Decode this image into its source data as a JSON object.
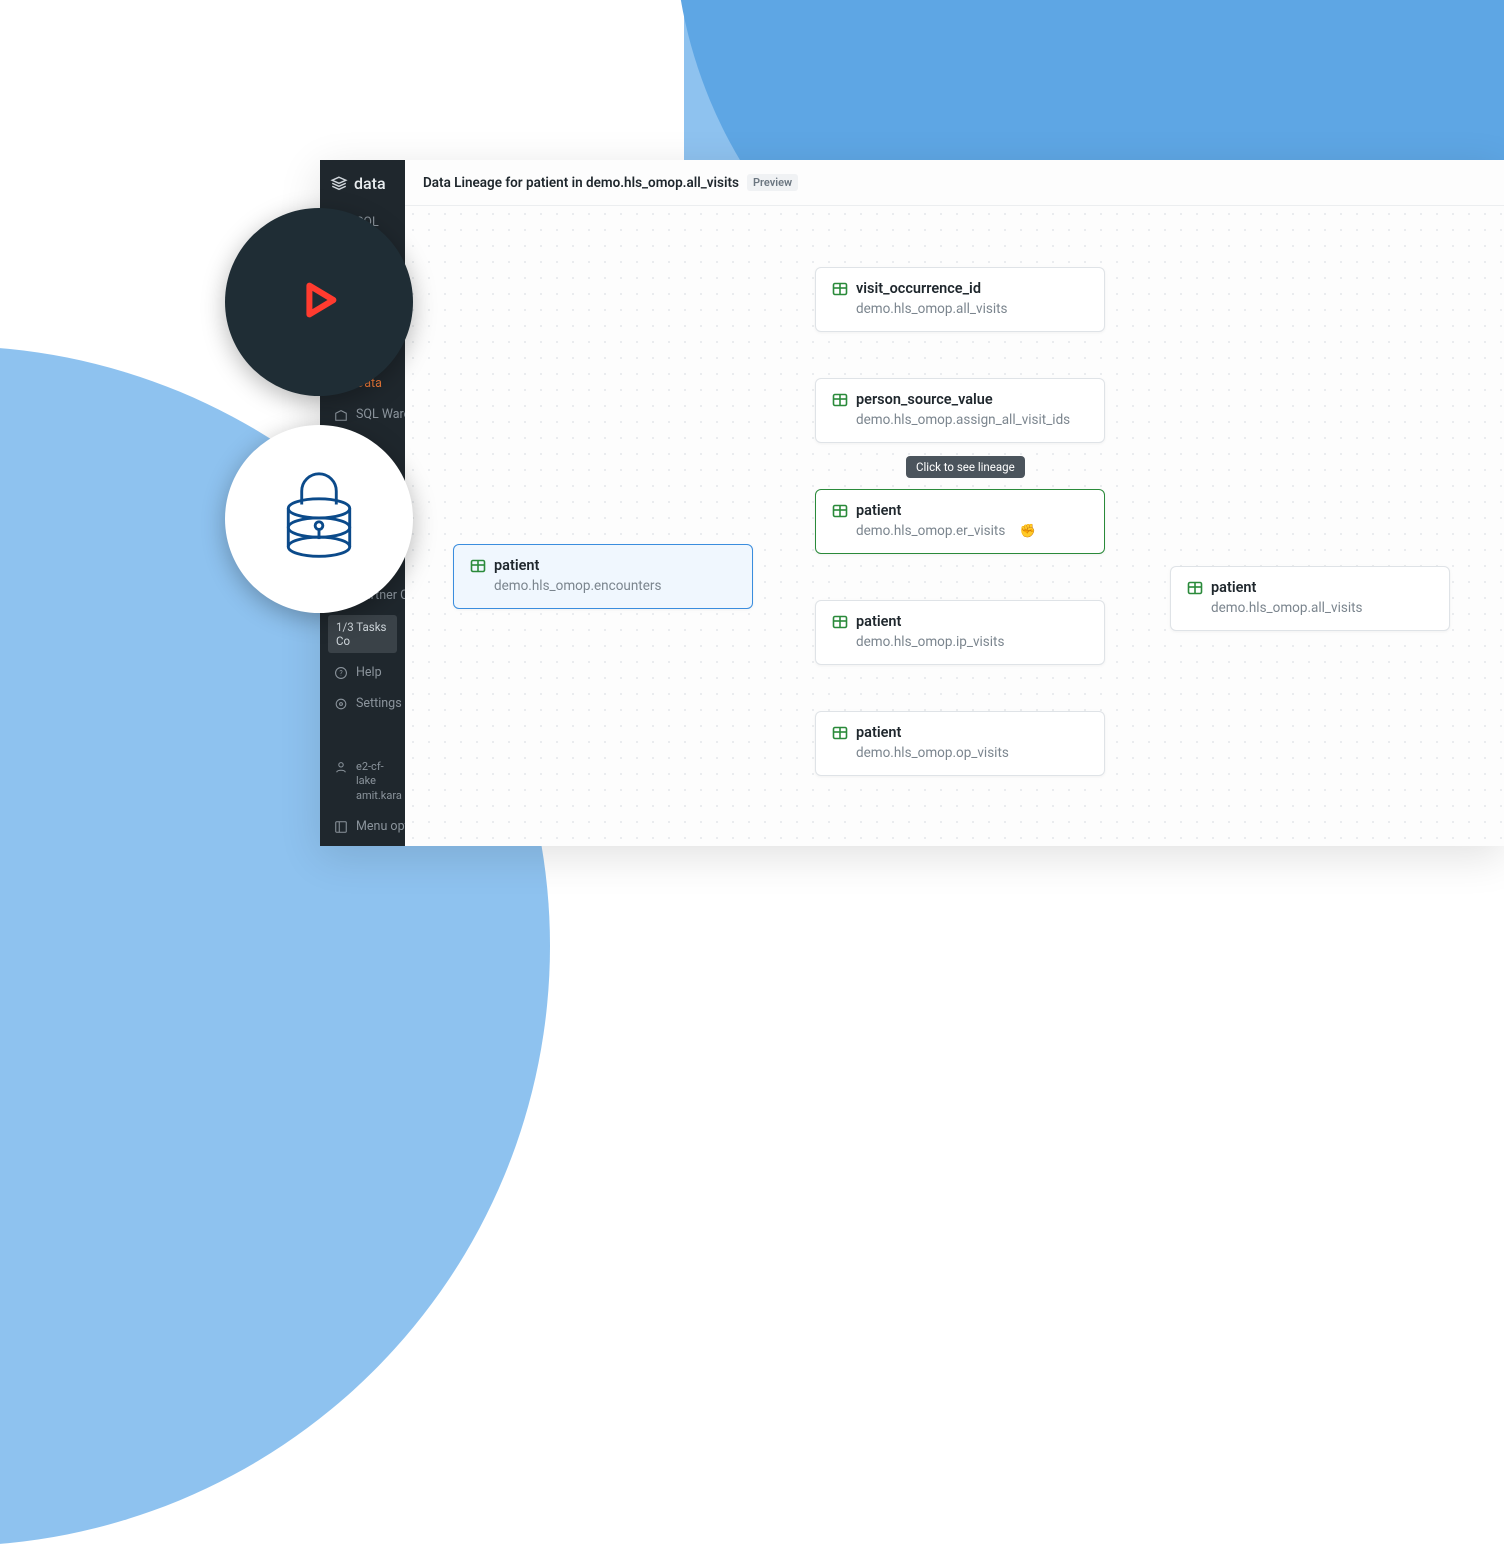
{
  "brand": "data",
  "header": {
    "title": "Data Lineage for patient in demo.hls_omop.all_visits",
    "badge": "Preview"
  },
  "sidebar": {
    "sql": "SQL",
    "data": "Data",
    "warehouse": "SQL Ware",
    "partner": "Partner C",
    "tasks": "1/3  Tasks Co",
    "help": "Help",
    "settings": "Settings",
    "user_line1": "e2-cf-lake",
    "user_line2": "amit.kara",
    "menu": "Menu opt"
  },
  "tooltip": "Click to see lineage",
  "nodes": {
    "source": {
      "title": "patient",
      "subtitle": "demo.hls_omop.encounters"
    },
    "n1": {
      "title": "visit_occurrence_id",
      "subtitle": "demo.hls_omop.all_visits"
    },
    "n2": {
      "title": "person_source_value",
      "subtitle": "demo.hls_omop.assign_all_visit_ids"
    },
    "n3": {
      "title": "patient",
      "subtitle": "demo.hls_omop.er_visits"
    },
    "n4": {
      "title": "patient",
      "subtitle": "demo.hls_omop.ip_visits"
    },
    "n5": {
      "title": "patient",
      "subtitle": "demo.hls_omop.op_visits"
    },
    "dest": {
      "title": "patient",
      "subtitle": "demo.hls_omop.all_visits"
    }
  }
}
